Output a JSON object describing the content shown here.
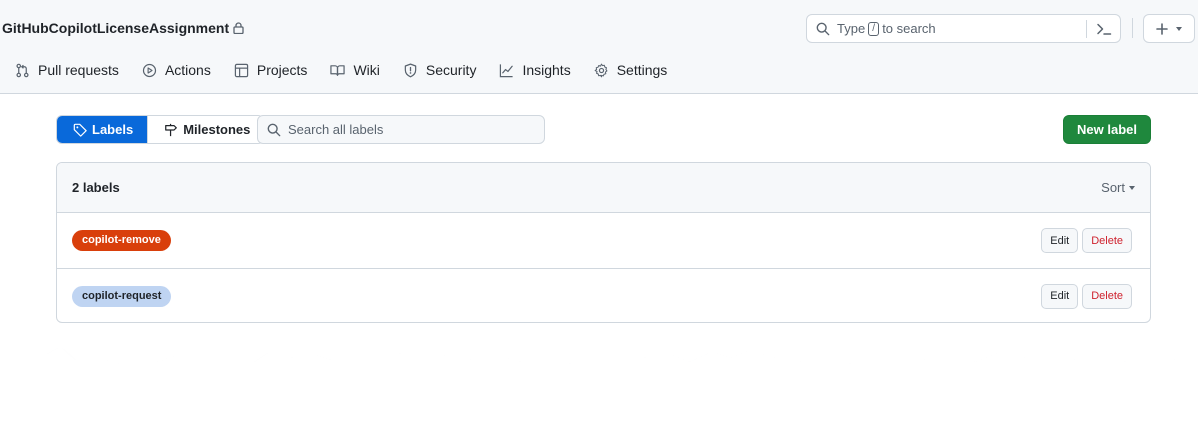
{
  "header": {
    "repo_name": "GitHubCopilotLicenseAssignment",
    "search": {
      "prefix": "Type",
      "key": "/",
      "suffix": "to search"
    }
  },
  "repo_nav": [
    {
      "label": "Pull requests",
      "icon": "git-pull-request-icon"
    },
    {
      "label": "Actions",
      "icon": "play-icon"
    },
    {
      "label": "Projects",
      "icon": "table-icon"
    },
    {
      "label": "Wiki",
      "icon": "book-icon"
    },
    {
      "label": "Security",
      "icon": "shield-icon"
    },
    {
      "label": "Insights",
      "icon": "graph-icon"
    },
    {
      "label": "Settings",
      "icon": "gear-icon"
    }
  ],
  "toolbar": {
    "labels_tab": "Labels",
    "milestones_tab": "Milestones",
    "search_placeholder": "Search all labels",
    "new_label": "New label"
  },
  "labels_box": {
    "count_text": "2 labels",
    "sort_label": "Sort",
    "edit_label": "Edit",
    "delete_label": "Delete",
    "labels": [
      {
        "name": "copilot-remove",
        "bg": "#d93f0b",
        "fg": "#ffffff"
      },
      {
        "name": "copilot-request",
        "bg": "#bfd4f2",
        "fg": "#1f2328"
      }
    ]
  },
  "colors": {
    "accent": "#0969da",
    "primary_button": "#1f883d",
    "danger_text": "#cf222e",
    "border": "#d0d7de",
    "header_bg": "#f6f8fa"
  }
}
